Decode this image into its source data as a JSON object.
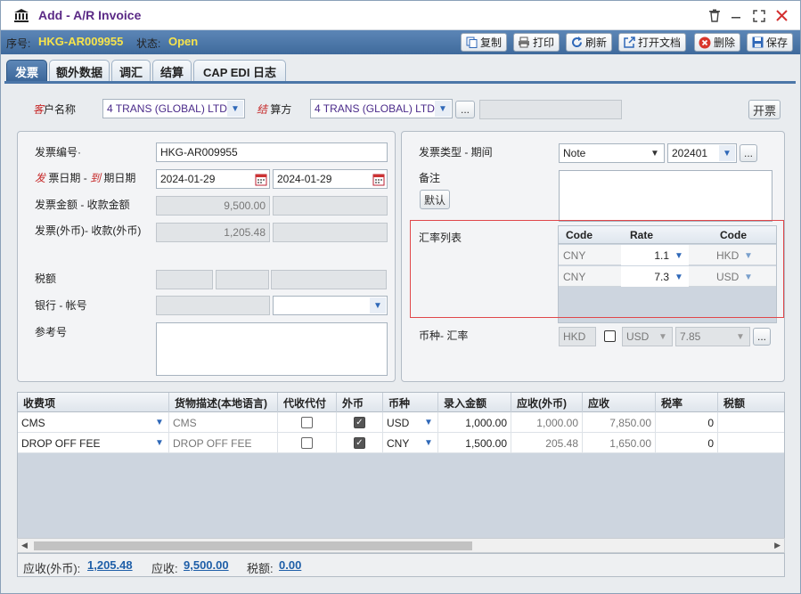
{
  "window": {
    "title": "Add - A/R Invoice",
    "colors": {
      "title": "#5b2a86",
      "status_value": "#f7e44c",
      "accent": "#3f6a9c"
    }
  },
  "status": {
    "no_label": "序号:",
    "no_value": "HKG-AR009955",
    "state_label": "状态:",
    "state_value": "Open"
  },
  "toolbar": {
    "copy": "复制",
    "print": "打印",
    "refresh": "刷新",
    "open_doc": "打开文档",
    "delete": "删除",
    "save": "保存"
  },
  "tabs": [
    "发票",
    "额外数据",
    "调汇",
    "结算",
    "CAP EDI 日志"
  ],
  "top": {
    "customer_label_red": "客",
    "customer_label": "户名称",
    "customer_value": "4 TRANS (GLOBAL) LTD",
    "settle_label_red": "结",
    "settle_label": "算方",
    "settle_value": "4 TRANS (GLOBAL) LTD",
    "ellipsis": "...",
    "invoice_btn": "开票"
  },
  "left": {
    "invoice_no_label": "发票编号·",
    "invoice_no": "HKG-AR009955",
    "date_label_red1": "发",
    "date_label_mid": "票日期 - ",
    "date_label_red2": "到",
    "date_label_end": "期日期",
    "invoice_date": "2024-01-29",
    "due_date": "2024-01-29",
    "amount_label": "发票金额 - 收款金额",
    "amount": "9,500.00",
    "fc_label": "发票(外币)- 收款(外币)",
    "fc_amount": "1,205.48",
    "tax_label": "税额",
    "bank_label": "银行 - 帐号",
    "ref_label": "参考号"
  },
  "right": {
    "type_label": "发票类型 - 期间",
    "type_value": "Note",
    "period_value": "202401",
    "remark_label": "备注",
    "default_btn": "默认",
    "rate_list_label": "汇率列表",
    "rate_headers": [
      "Code",
      "Rate",
      "Code"
    ],
    "rates": [
      {
        "from": "CNY",
        "rate": "1.1",
        "to": "HKD"
      },
      {
        "from": "CNY",
        "rate": "7.3",
        "to": "USD"
      }
    ],
    "currency_label": "币种- 汇率",
    "base_currency": "HKD",
    "fx_currency": "USD",
    "fx_rate": "7.85"
  },
  "grid": {
    "headers": [
      "收费项",
      "货物描述(本地语言)",
      "代收代付",
      "外币",
      "币种",
      "录入金额",
      "应收(外币)",
      "应收",
      "税率",
      "税额"
    ],
    "rows": [
      {
        "item": "CMS",
        "desc": "CMS",
        "collect": false,
        "foreign": true,
        "currency": "USD",
        "input": "1,000.00",
        "ar_fc": "1,000.00",
        "ar": "7,850.00",
        "tax_rate": "0"
      },
      {
        "item": "DROP OFF FEE",
        "desc": "DROP OFF FEE",
        "collect": false,
        "foreign": true,
        "currency": "CNY",
        "input": "1,500.00",
        "ar_fc": "205.48",
        "ar": "1,650.00",
        "tax_rate": "0"
      }
    ]
  },
  "footer": {
    "ar_fc_label": "应收(外币):",
    "ar_fc": "1,205.48",
    "ar_label": "应收:",
    "ar": "9,500.00",
    "tax_label": "税额:",
    "tax": "0.00"
  },
  "icons": [
    "bank-icon",
    "trash-icon",
    "minimize-icon",
    "maximize-icon",
    "close-icon",
    "copy-icon",
    "print-icon",
    "refresh-icon",
    "open-doc-icon",
    "delete-icon",
    "save-icon",
    "calendar-icon",
    "chevron-down-icon"
  ]
}
